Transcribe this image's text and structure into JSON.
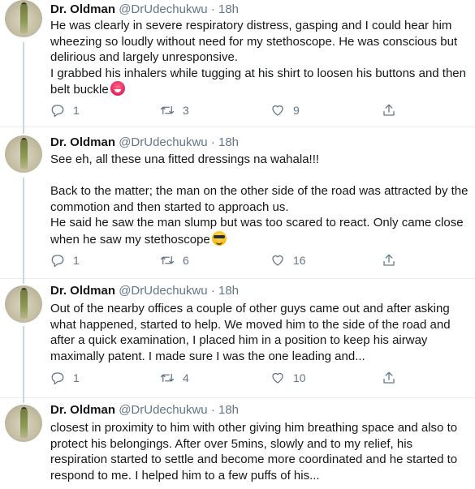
{
  "tweets": [
    {
      "name": "Dr. Oldman",
      "handle": "@DrUdechukwu",
      "dot": "·",
      "time": "18h",
      "text": "He was clearly in severe respiratory distress, gasping and I could hear him wheezing so loudly without need for my stethoscope. He was conscious but delirious and largely unresponsive.\nI grabbed his inhalers while tugging at his shirt to loosen his buttons and then belt buckle",
      "emoji": "hot-face-emoji",
      "replies": "1",
      "retweets": "3",
      "likes": "9"
    },
    {
      "name": "Dr. Oldman",
      "handle": "@DrUdechukwu",
      "dot": "·",
      "time": "18h",
      "text": "See eh, all these una fitted dressings na wahala!!!\n\nBack to the matter; the man on the other side of the road was attracted by the commotion and then started to approach us.\nHe said he saw the man slump but was too scared to react. Only came close when he saw my stethoscope",
      "emoji": "sunglasses-emoji",
      "replies": "1",
      "retweets": "6",
      "likes": "16"
    },
    {
      "name": "Dr. Oldman",
      "handle": "@DrUdechukwu",
      "dot": "·",
      "time": "18h",
      "text": "Out of the nearby offices a couple of other guys came out and after asking what happened, started to help. We moved him to the side of the road and after a quick examination, I placed him in a position to keep his airway maximally patent. I made sure I was the one leading and...",
      "emoji": "",
      "replies": "1",
      "retweets": "4",
      "likes": "10"
    },
    {
      "name": "Dr. Oldman",
      "handle": "@DrUdechukwu",
      "dot": "·",
      "time": "18h",
      "text": "closest in proximity to him with other giving him breathing space and also to protect his belongings. After over 5mins, slowly and to my relief, his respiration started to settle and become more coordinated and he started to respond to me. I helped him to a few puffs of his...",
      "emoji": "",
      "replies": "",
      "retweets": "",
      "likes": ""
    }
  ],
  "icons": {
    "reply": "reply-icon",
    "retweet": "retweet-icon",
    "like": "heart-icon",
    "share": "share-icon"
  },
  "colors": {
    "text": "#14171a",
    "muted": "#657786",
    "divider": "#e6ecf0",
    "thread_line": "#ccd6dd"
  }
}
